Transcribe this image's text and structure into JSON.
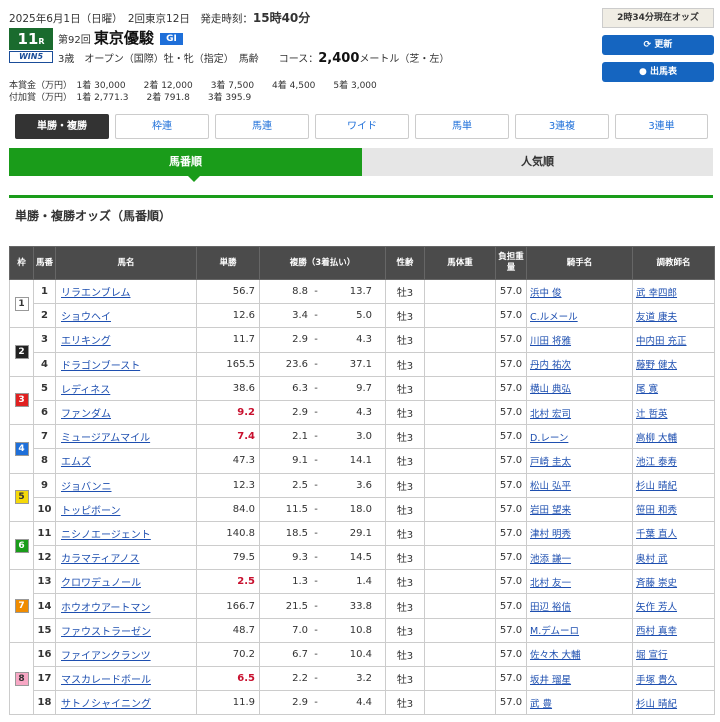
{
  "header": {
    "date_line": "2025年6月1日（日曜）　2回東京12日　発走時刻：",
    "post_time": "15時40分",
    "race_number": "11",
    "race_unit": "R",
    "win5_label": "WIN5",
    "edition": "第92回",
    "race_name": "東京優駿",
    "grade": "GI",
    "conditions": "3歳　オープン（国際）牡・牝（指定）　馬齢　　コース：",
    "distance": "2,400",
    "course_detail": "メートル（芝・左）",
    "prize_main_label": "本賞金（万円）",
    "prize_main": "1着 30,000　　2着 12,000　　3着 7,500　　4着 4,500　　5着 3,000",
    "prize_add_label": "付加賞（万円）",
    "prize_add": "1着 2,771.3　　2着 791.8　　3着 395.9"
  },
  "side": {
    "odds_time": "2時34分現在オッズ",
    "refresh_button": "⟳ 更新",
    "entries_button": "● 出馬表"
  },
  "bet_tabs": [
    {
      "label": "単勝・複勝",
      "active": true
    },
    {
      "label": "枠連",
      "active": false
    },
    {
      "label": "馬連",
      "active": false
    },
    {
      "label": "ワイド",
      "active": false
    },
    {
      "label": "馬単",
      "active": false
    },
    {
      "label": "3連複",
      "active": false
    },
    {
      "label": "3連単",
      "active": false
    }
  ],
  "sort_tabs": [
    {
      "label": "馬番順",
      "active": true
    },
    {
      "label": "人気順",
      "active": false
    }
  ],
  "section_title": "単勝・複勝オッズ（馬番順）",
  "table": {
    "headers": [
      "枠",
      "馬番",
      "馬名",
      "単勝",
      "複勝（3着払い）",
      "性齢",
      "馬体重",
      "負担重量",
      "騎手名",
      "調教師名"
    ],
    "waku_colors": {
      "1": {
        "bg": "#ffffff",
        "fg": "#333333"
      },
      "2": {
        "bg": "#222222",
        "fg": "#ffffff"
      },
      "3": {
        "bg": "#e02020",
        "fg": "#ffffff"
      },
      "4": {
        "bg": "#1e6fd9",
        "fg": "#ffffff"
      },
      "5": {
        "bg": "#f5d90a",
        "fg": "#333333"
      },
      "6": {
        "bg": "#1a9c1a",
        "fg": "#ffffff"
      },
      "7": {
        "bg": "#f08c00",
        "fg": "#ffffff"
      },
      "8": {
        "bg": "#f7a7c4",
        "fg": "#333333"
      }
    },
    "rows": [
      {
        "waku": "1",
        "num": "1",
        "horse": "リラエンブレム",
        "win": "56.7",
        "fav": false,
        "place_lo": "8.8",
        "place_hi": "13.7",
        "sex_age": "牡3",
        "body_weight": "",
        "weight": "57.0",
        "jockey": "浜中 俊",
        "trainer": "武 幸四郎"
      },
      {
        "waku": "1",
        "num": "2",
        "horse": "ショウヘイ",
        "win": "12.6",
        "fav": false,
        "place_lo": "3.4",
        "place_hi": "5.0",
        "sex_age": "牡3",
        "body_weight": "",
        "weight": "57.0",
        "jockey": "C.ルメール",
        "trainer": "友道 康夫"
      },
      {
        "waku": "2",
        "num": "3",
        "horse": "エリキング",
        "win": "11.7",
        "fav": false,
        "place_lo": "2.9",
        "place_hi": "4.3",
        "sex_age": "牡3",
        "body_weight": "",
        "weight": "57.0",
        "jockey": "川田 将雅",
        "trainer": "中内田 充正"
      },
      {
        "waku": "2",
        "num": "4",
        "horse": "ドラゴンブースト",
        "win": "165.5",
        "fav": false,
        "place_lo": "23.6",
        "place_hi": "37.1",
        "sex_age": "牡3",
        "body_weight": "",
        "weight": "57.0",
        "jockey": "丹内 祐次",
        "trainer": "藤野 健太"
      },
      {
        "waku": "3",
        "num": "5",
        "horse": "レディネス",
        "win": "38.6",
        "fav": false,
        "place_lo": "6.3",
        "place_hi": "9.7",
        "sex_age": "牡3",
        "body_weight": "",
        "weight": "57.0",
        "jockey": "横山 典弘",
        "trainer": "尾 寛"
      },
      {
        "waku": "3",
        "num": "6",
        "horse": "ファンダム",
        "win": "9.2",
        "fav": true,
        "place_lo": "2.9",
        "place_hi": "4.3",
        "sex_age": "牡3",
        "body_weight": "",
        "weight": "57.0",
        "jockey": "北村 宏司",
        "trainer": "辻 哲英"
      },
      {
        "waku": "4",
        "num": "7",
        "horse": "ミュージアムマイル",
        "win": "7.4",
        "fav": true,
        "place_lo": "2.1",
        "place_hi": "3.0",
        "sex_age": "牡3",
        "body_weight": "",
        "weight": "57.0",
        "jockey": "D.レーン",
        "trainer": "高柳 大輔"
      },
      {
        "waku": "4",
        "num": "8",
        "horse": "エムズ",
        "win": "47.3",
        "fav": false,
        "place_lo": "9.1",
        "place_hi": "14.1",
        "sex_age": "牡3",
        "body_weight": "",
        "weight": "57.0",
        "jockey": "戸崎 圭太",
        "trainer": "池江 泰寿"
      },
      {
        "waku": "5",
        "num": "9",
        "horse": "ジョバンニ",
        "win": "12.3",
        "fav": false,
        "place_lo": "2.5",
        "place_hi": "3.6",
        "sex_age": "牡3",
        "body_weight": "",
        "weight": "57.0",
        "jockey": "松山 弘平",
        "trainer": "杉山 晴紀"
      },
      {
        "waku": "5",
        "num": "10",
        "horse": "トッピボーン",
        "win": "84.0",
        "fav": false,
        "place_lo": "11.5",
        "place_hi": "18.0",
        "sex_age": "牡3",
        "body_weight": "",
        "weight": "57.0",
        "jockey": "岩田 望来",
        "trainer": "笹田 和秀"
      },
      {
        "waku": "6",
        "num": "11",
        "horse": "ニシノエージェント",
        "win": "140.8",
        "fav": false,
        "place_lo": "18.5",
        "place_hi": "29.1",
        "sex_age": "牡3",
        "body_weight": "",
        "weight": "57.0",
        "jockey": "津村 明秀",
        "trainer": "千葉 直人"
      },
      {
        "waku": "6",
        "num": "12",
        "horse": "カラマティアノス",
        "win": "79.5",
        "fav": false,
        "place_lo": "9.3",
        "place_hi": "14.5",
        "sex_age": "牡3",
        "body_weight": "",
        "weight": "57.0",
        "jockey": "池添 謙一",
        "trainer": "奥村 武"
      },
      {
        "waku": "7",
        "num": "13",
        "horse": "クロワデュノール",
        "win": "2.5",
        "fav": true,
        "place_lo": "1.3",
        "place_hi": "1.4",
        "sex_age": "牡3",
        "body_weight": "",
        "weight": "57.0",
        "jockey": "北村 友一",
        "trainer": "斉藤 崇史"
      },
      {
        "waku": "7",
        "num": "14",
        "horse": "ホウオウアートマン",
        "win": "166.7",
        "fav": false,
        "place_lo": "21.5",
        "place_hi": "33.8",
        "sex_age": "牡3",
        "body_weight": "",
        "weight": "57.0",
        "jockey": "田辺 裕信",
        "trainer": "矢作 芳人"
      },
      {
        "waku": "7",
        "num": "15",
        "horse": "ファウストラーゼン",
        "win": "48.7",
        "fav": false,
        "place_lo": "7.0",
        "place_hi": "10.8",
        "sex_age": "牡3",
        "body_weight": "",
        "weight": "57.0",
        "jockey": "M.デムーロ",
        "trainer": "西村 真幸"
      },
      {
        "waku": "8",
        "num": "16",
        "horse": "ファイアンクランツ",
        "win": "70.2",
        "fav": false,
        "place_lo": "6.7",
        "place_hi": "10.4",
        "sex_age": "牡3",
        "body_weight": "",
        "weight": "57.0",
        "jockey": "佐々木 大輔",
        "trainer": "堀 宣行"
      },
      {
        "waku": "8",
        "num": "17",
        "horse": "マスカレードボール",
        "win": "6.5",
        "fav": true,
        "place_lo": "2.2",
        "place_hi": "3.2",
        "sex_age": "牡3",
        "body_weight": "",
        "weight": "57.0",
        "jockey": "坂井 瑠星",
        "trainer": "手塚 貴久"
      },
      {
        "waku": "8",
        "num": "18",
        "horse": "サトノシャイニング",
        "win": "11.9",
        "fav": false,
        "place_lo": "2.9",
        "place_hi": "4.4",
        "sex_age": "牡3",
        "body_weight": "",
        "weight": "57.0",
        "jockey": "武 豊",
        "trainer": "杉山 晴紀"
      }
    ]
  }
}
